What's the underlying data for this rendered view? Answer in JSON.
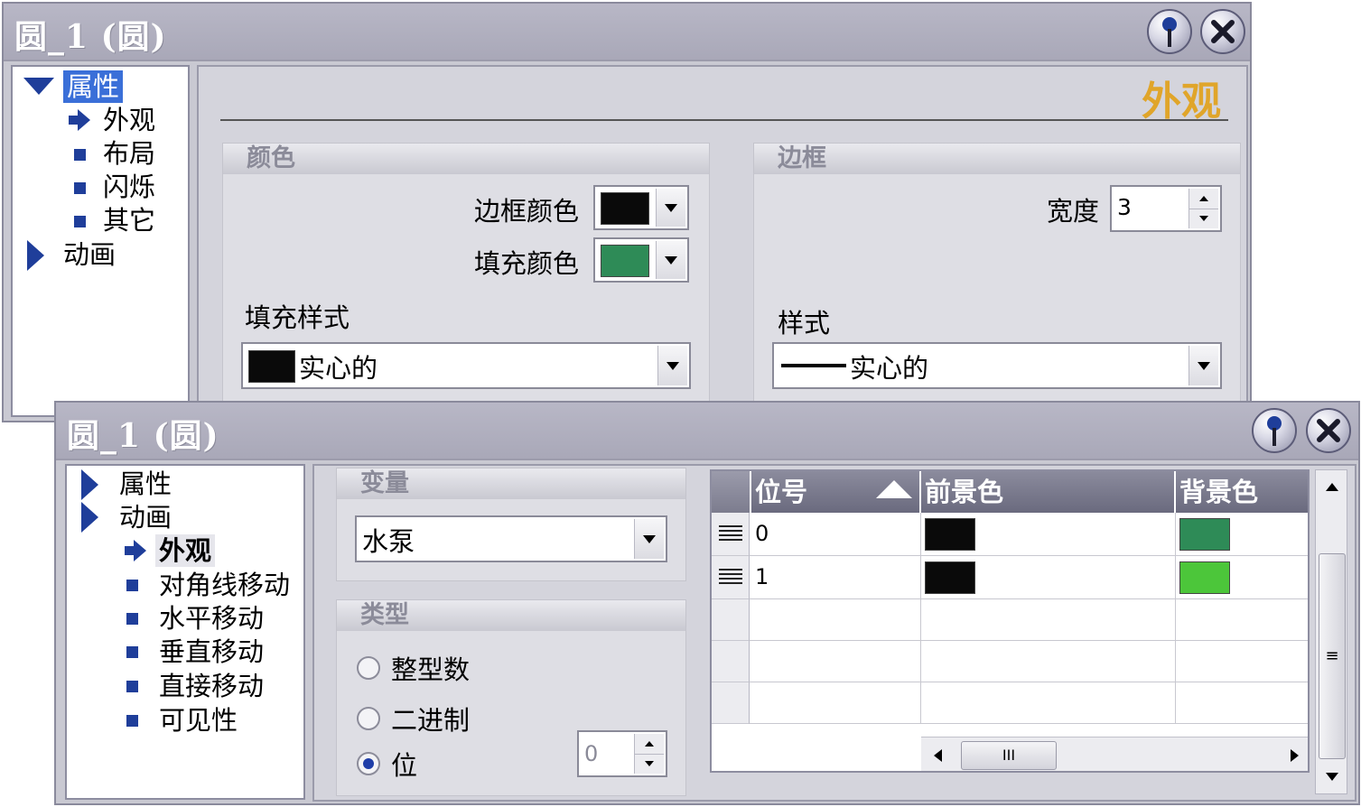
{
  "window1": {
    "title": "圆_1 (圆)",
    "tree": {
      "root_label": "属性",
      "children": [
        "外观",
        "布局",
        "闪烁",
        "其它"
      ],
      "sibling_label": "动画"
    },
    "section_title": "外观",
    "color_group": {
      "header": "颜色",
      "border_color_label": "边框颜色",
      "border_color": "#0a0a0a",
      "fill_color_label": "填充颜色",
      "fill_color": "#2e8b57",
      "fill_style_label": "填充样式",
      "fill_style_value": "实心的"
    },
    "border_group": {
      "header": "边框",
      "width_label": "宽度",
      "width_value": "3",
      "style_label": "样式",
      "style_value": "实心的"
    }
  },
  "window2": {
    "title": "圆_1 (圆)",
    "tree": {
      "item1": "属性",
      "item2": "动画",
      "selected": "外观",
      "children": [
        "对角线移动",
        "水平移动",
        "垂直移动",
        "直接移动",
        "可见性"
      ]
    },
    "variable_group": {
      "header": "变量",
      "value": "水泵"
    },
    "type_group": {
      "header": "类型",
      "options": [
        "整型数",
        "二进制",
        "位"
      ],
      "selected_index": 2,
      "bit_value": "0"
    },
    "table": {
      "columns": [
        "位号",
        "前景色",
        "背景色"
      ],
      "rows": [
        {
          "bit": "0",
          "fg": "#0a0a0a",
          "bg": "#2e8b57"
        },
        {
          "bit": "1",
          "fg": "#0a0a0a",
          "bg": "#4cc63a"
        }
      ],
      "hscroll_thumb_label": "III",
      "vscroll_thumb_label": "≡"
    }
  },
  "colors": {
    "accent_title": "#e0a52a",
    "tree_selection": "#3a6fd8",
    "tree_icon": "#1f3e9a"
  }
}
